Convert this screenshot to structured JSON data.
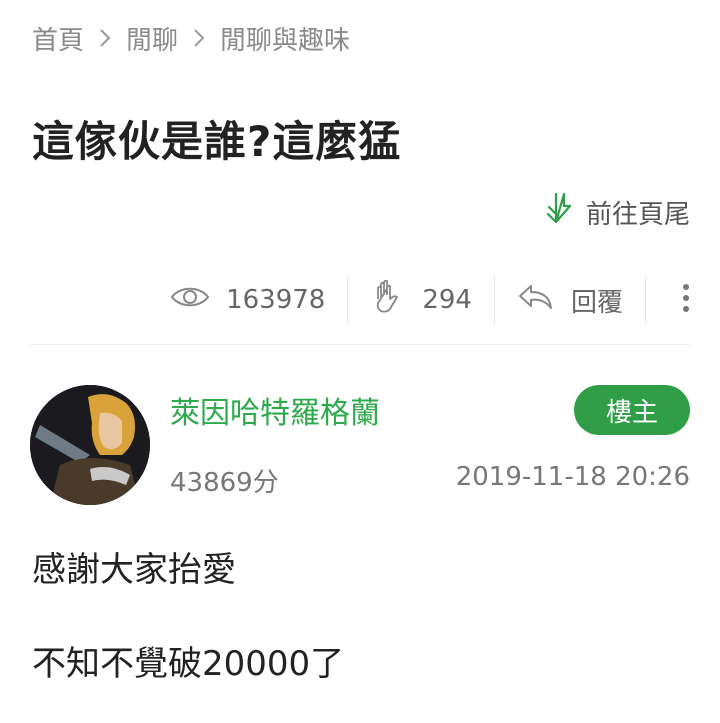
{
  "breadcrumb": [
    "首頁",
    "閒聊",
    "閒聊與趣味"
  ],
  "title": "這傢伙是誰?這麼猛",
  "goto_end_label": "前往頁尾",
  "stats": {
    "views": "163978",
    "likes": "294",
    "reply_label": "回覆"
  },
  "post": {
    "author": "萊因哈特羅格蘭",
    "badge": "樓主",
    "score": "43869分",
    "date": "2019-11-18 20:26",
    "content": [
      "感謝大家抬愛",
      "不知不覺破20000了"
    ]
  },
  "colors": {
    "accent_green": "#2f9e47",
    "author_green": "#2eaa4d"
  },
  "icons": [
    "chevron-right-icon",
    "arrow-down-icon",
    "eye-icon",
    "clap-icon",
    "reply-icon",
    "more-vertical-icon"
  ]
}
